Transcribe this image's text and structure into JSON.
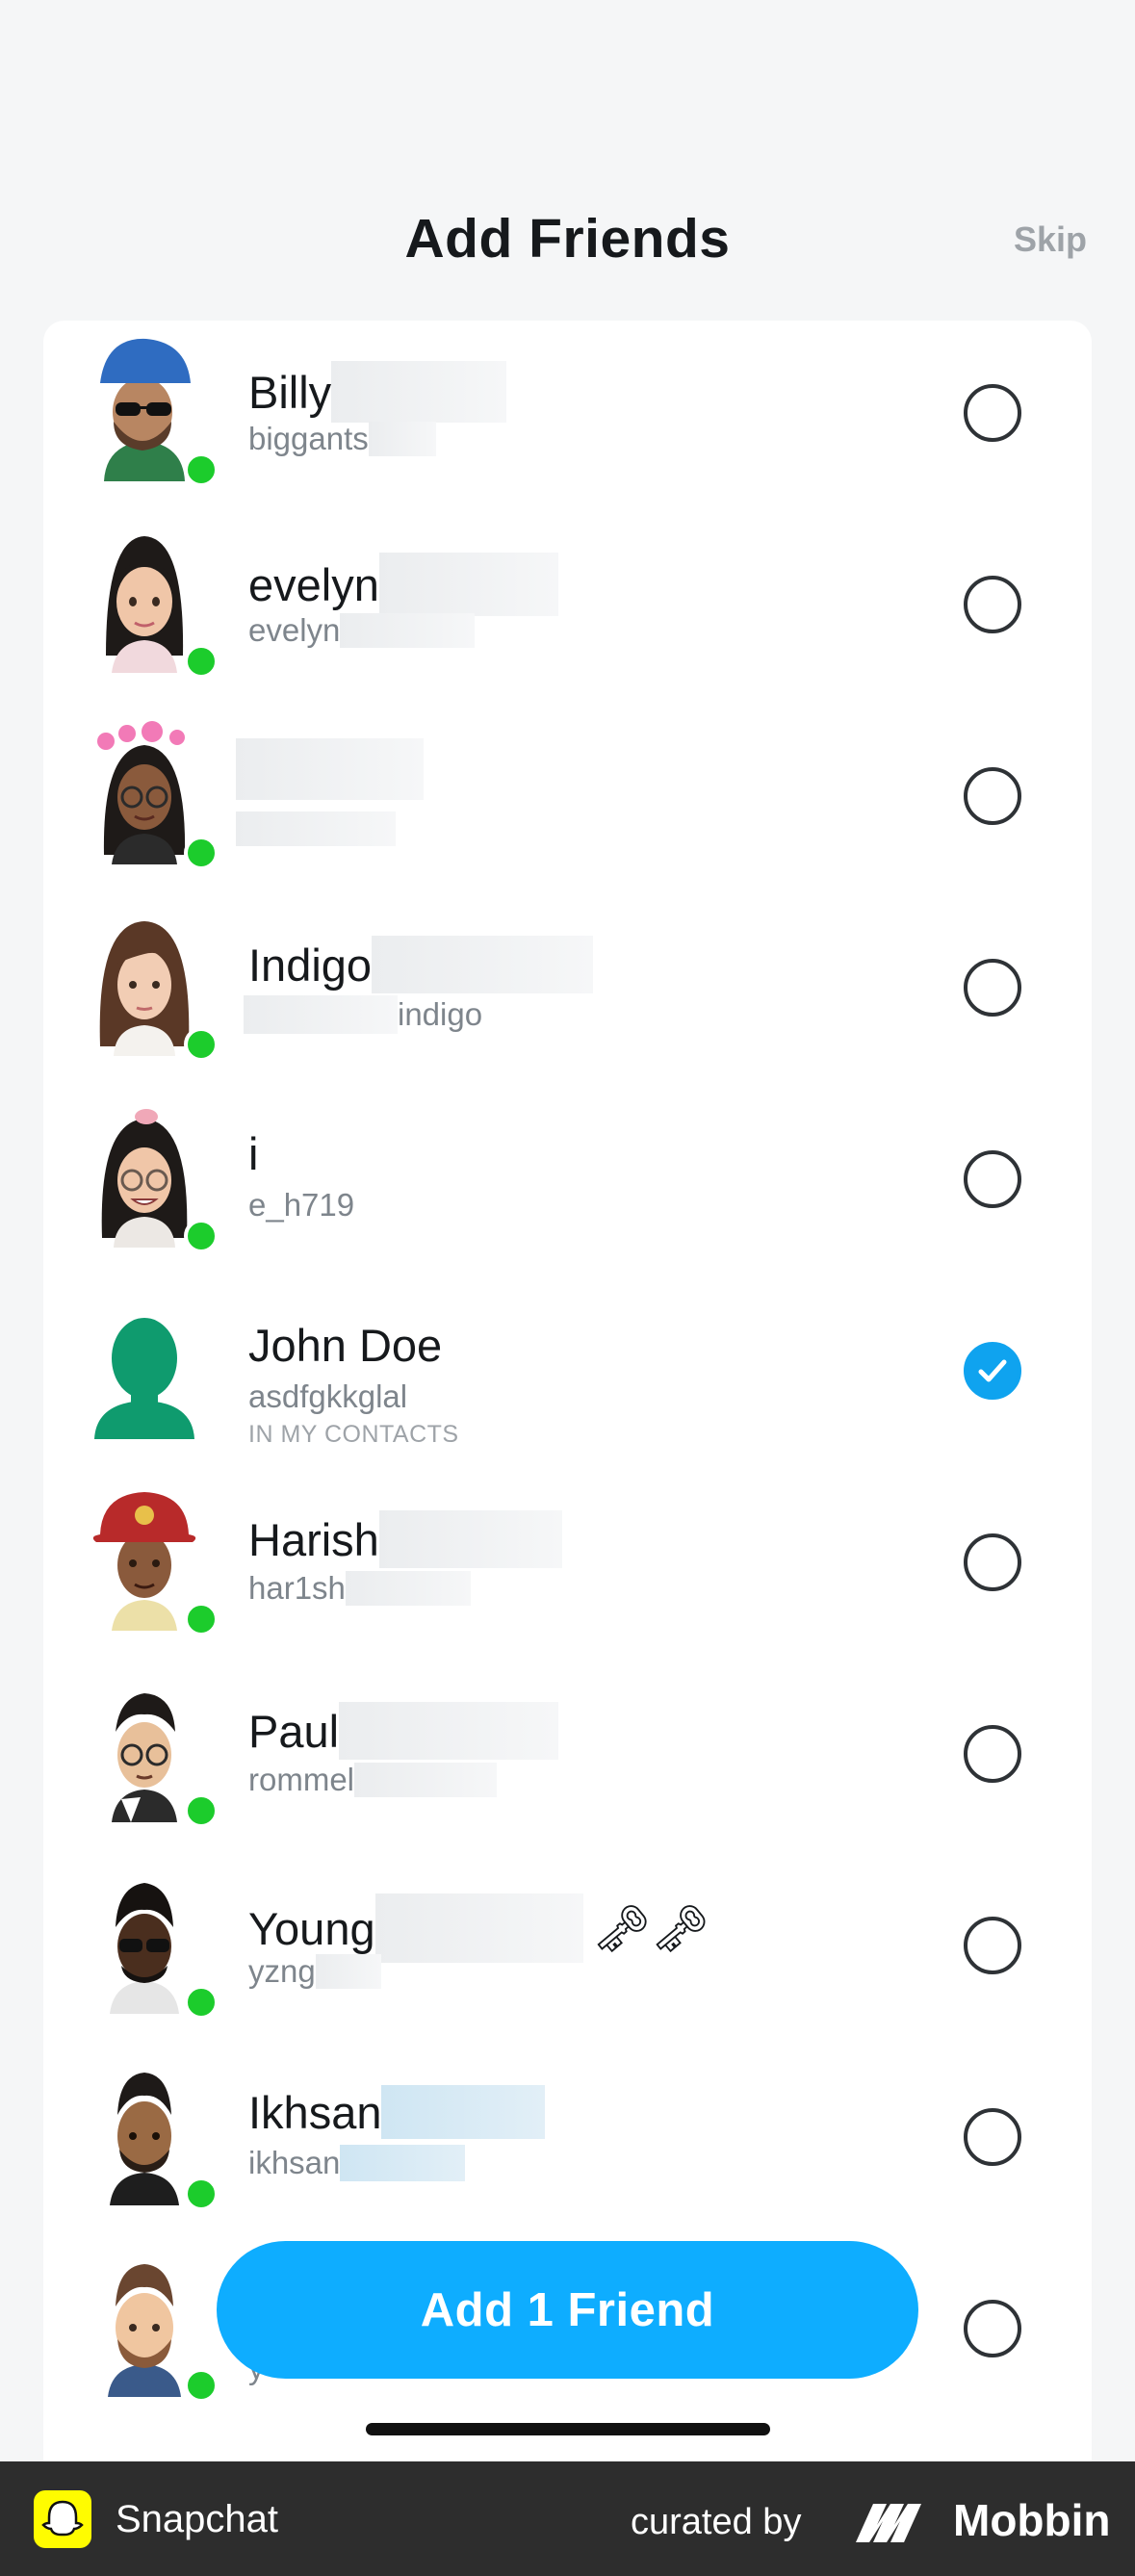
{
  "header": {
    "title": "Add Friends",
    "skip_label": "Skip"
  },
  "friends": [
    {
      "name": "Billy",
      "username": "biggants",
      "online": true,
      "selected": false
    },
    {
      "name": "evelyn",
      "username": "evelyn",
      "online": true,
      "selected": false
    },
    {
      "name": "",
      "username": "",
      "online": true,
      "selected": false
    },
    {
      "name": "Indigo",
      "username": "indigo",
      "online": true,
      "selected": false
    },
    {
      "name": "i",
      "username": "e_h719",
      "online": true,
      "selected": false
    },
    {
      "name": "John Doe",
      "username": "asdfgkkglal",
      "subtitle": "IN MY CONTACTS",
      "online": false,
      "selected": true
    },
    {
      "name": "Harish",
      "username": "har1sh",
      "online": true,
      "selected": false
    },
    {
      "name": "Paul",
      "username": "rommel",
      "online": true,
      "selected": false
    },
    {
      "name": "Young",
      "username": "yzng",
      "online": true,
      "selected": false,
      "emoji": "🗝🗝"
    },
    {
      "name": "Ikhsan",
      "username": "ikhsan",
      "online": true,
      "selected": false
    },
    {
      "name": "",
      "username": "y",
      "online": true,
      "selected": false
    }
  ],
  "add_button": {
    "label": "Add 1 Friend"
  },
  "footer": {
    "app_name": "Snapchat",
    "curated_by": "curated by",
    "brand": "Mobbin"
  },
  "colors": {
    "accent": "#0eadff",
    "online": "#1ccc2c",
    "selected": "#0fa3ef"
  },
  "icons": {
    "checked": "check-icon",
    "unchecked": "empty-circle-icon",
    "online": "online-dot-icon"
  }
}
